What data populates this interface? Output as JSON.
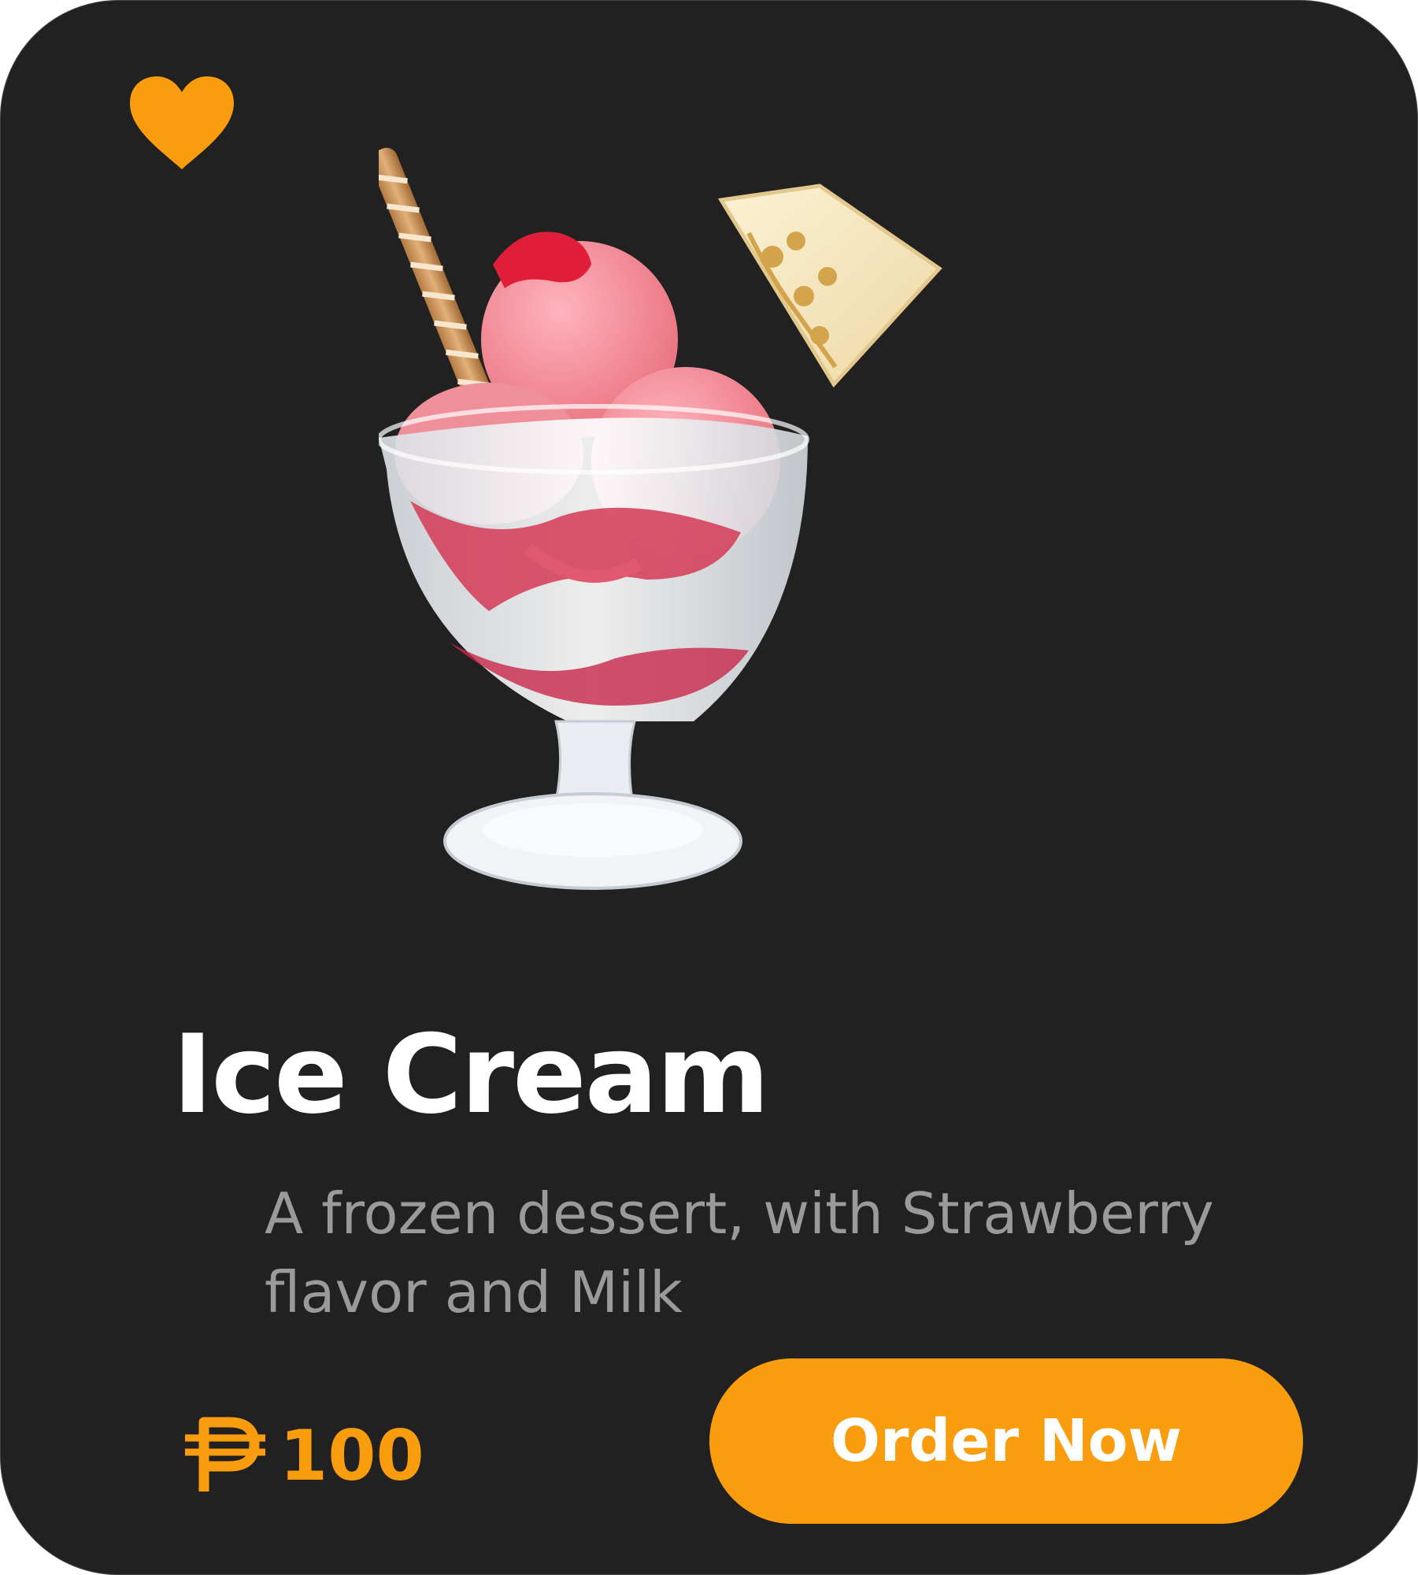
{
  "product": {
    "name": "Ice Cream",
    "description": "A frozen dessert, with Strawberry flavor and Milk",
    "price": "100",
    "image_icon": "ice-cream-sundae-image"
  },
  "actions": {
    "order_label": "Order Now",
    "favorite_icon": "heart-icon"
  },
  "colors": {
    "card_background": "#212121",
    "accent": "#f99d0f",
    "title": "#ffffff",
    "description": "#9a9a9a"
  }
}
